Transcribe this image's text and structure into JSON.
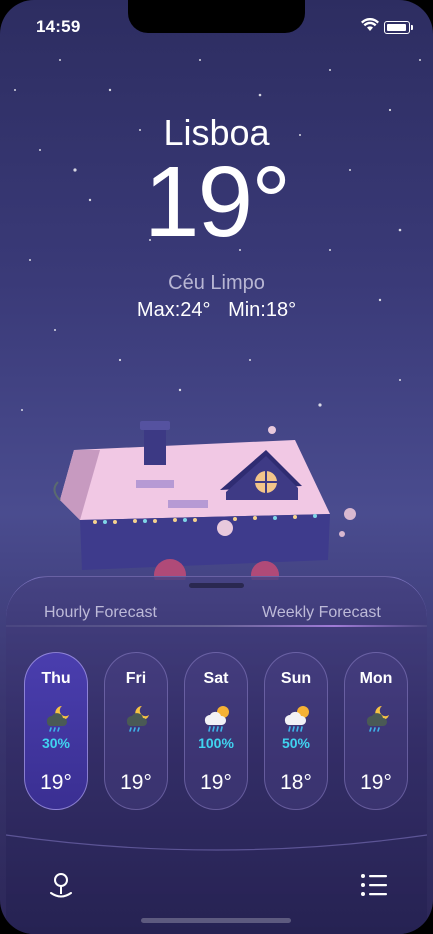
{
  "status_bar": {
    "time": "14:59"
  },
  "weather": {
    "city": "Lisboa",
    "temperature": "19°",
    "condition": "Céu Limpo",
    "max": "Max:24°",
    "min": "Min:18°"
  },
  "forecast_tabs": {
    "hourly": "Hourly Forecast",
    "weekly": "Weekly Forecast"
  },
  "forecast": [
    {
      "day": "Thu",
      "icon": "moon-cloud-rain-icon",
      "precip": "30%",
      "temp": "19°",
      "active": true
    },
    {
      "day": "Fri",
      "icon": "moon-cloud-rain-icon",
      "precip": "",
      "temp": "19°",
      "active": false
    },
    {
      "day": "Sat",
      "icon": "sun-cloud-rain-icon",
      "precip": "100%",
      "temp": "19°",
      "active": false
    },
    {
      "day": "Sun",
      "icon": "sun-cloud-rain-icon",
      "precip": "50%",
      "temp": "18°",
      "active": false
    },
    {
      "day": "Mon",
      "icon": "moon-cloud-rain-icon",
      "precip": "",
      "temp": "19°",
      "active": false
    }
  ],
  "tab_bar": {
    "left_icon": "location-pin-icon",
    "right_icon": "list-icon"
  },
  "colors": {
    "background": "#3a3a78",
    "active_card": "#4a3eae",
    "precip": "#40d3f0"
  }
}
